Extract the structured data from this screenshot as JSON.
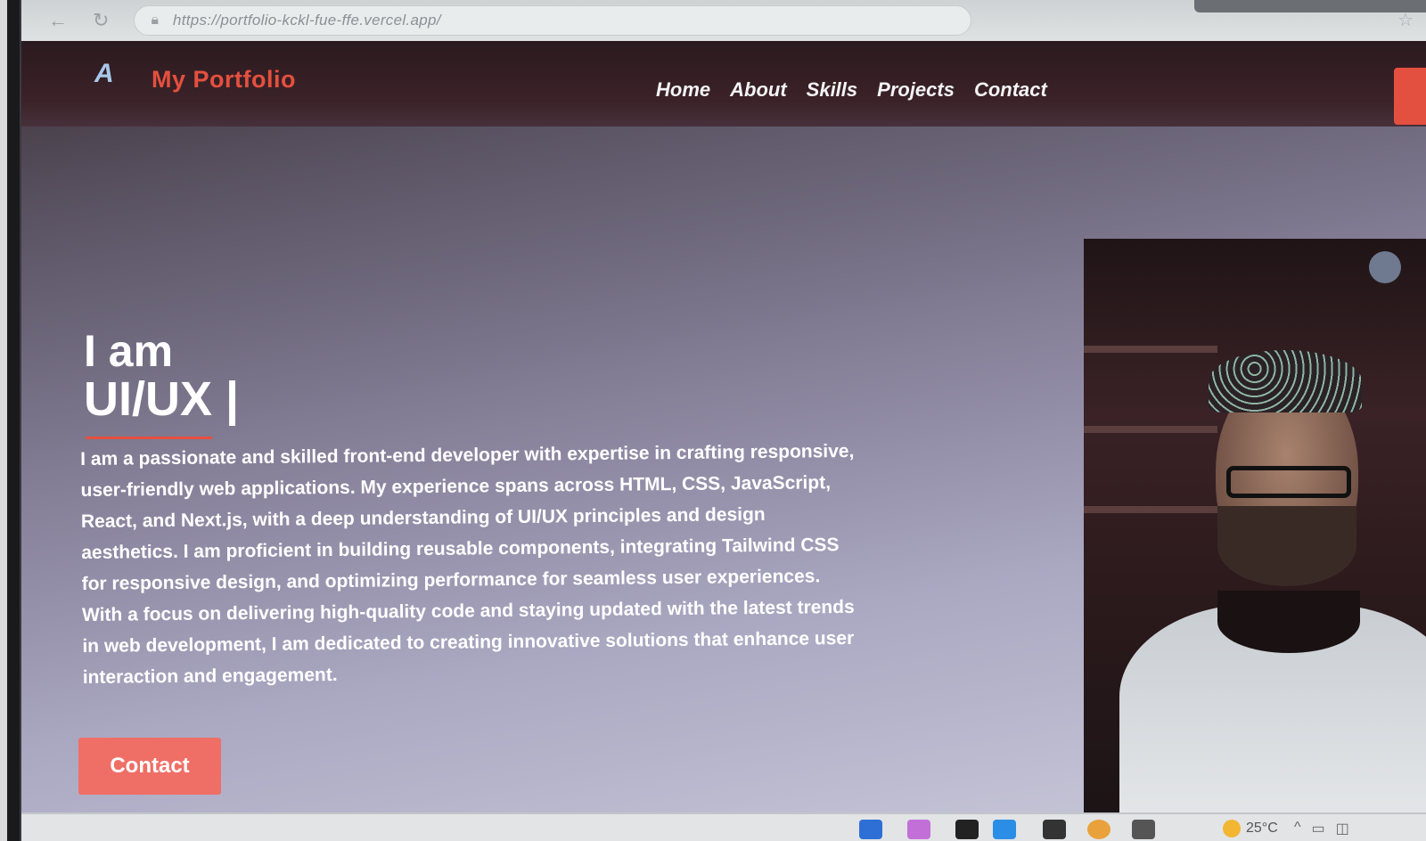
{
  "browser": {
    "url": "https://portfolio-kckl-fue-ffe.vercel.app/",
    "back_icon": "arrow-left-icon",
    "reload_icon": "reload-icon",
    "lock_icon": "lock-icon"
  },
  "site": {
    "logo_text": "My Portfolio",
    "nav": [
      "Home",
      "About",
      "Skills",
      "Projects",
      "Contact"
    ],
    "hero": {
      "pre": "I am",
      "role": "UI/UX |",
      "description": "I am a passionate and skilled front-end developer with expertise in crafting responsive, user-friendly web applications. My experience spans across HTML, CSS, JavaScript, React, and Next.js, with a deep understanding of UI/UX principles and design aesthetics. I am proficient in building reusable components, integrating Tailwind CSS for responsive design, and optimizing performance for seamless user experiences. With a focus on delivering high-quality code and staying updated with the latest trends in web development, I am dedicated to creating innovative solutions that enhance user interaction and engagement.",
      "contact_button": "Contact"
    },
    "colors": {
      "accent": "#e4503f",
      "button": "#ef6f67",
      "nav_bg": "#2a1a1f"
    }
  },
  "taskbar": {
    "temperature": "25°C"
  }
}
